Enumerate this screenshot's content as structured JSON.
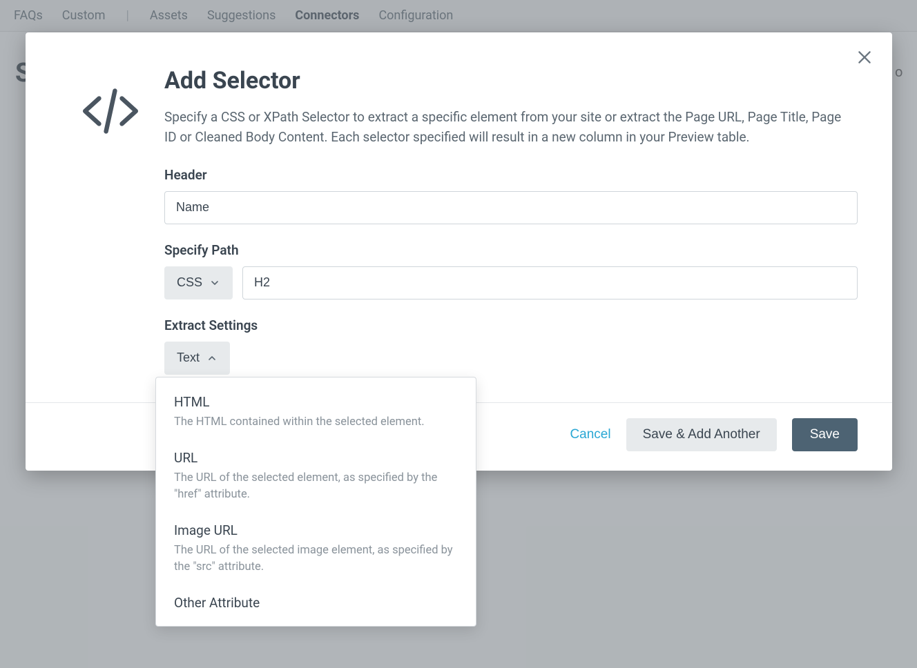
{
  "nav": {
    "items": [
      "FAQs",
      "Custom",
      "|",
      "Assets",
      "Suggestions",
      "Connectors",
      "Configuration"
    ],
    "active_index": 5
  },
  "bg": {
    "left_letter": "S",
    "right_letter": "o"
  },
  "modal": {
    "title": "Add Selector",
    "description": "Specify a CSS or XPath Selector to extract a specific element from your site or extract the Page URL, Page Title, Page ID or Cleaned Body Content. Each selector specified will result in a new column in your Preview table.",
    "header_label": "Header",
    "header_value": "Name",
    "specify_path_label": "Specify Path",
    "path_type_selected": "CSS",
    "path_value": "H2",
    "extract_label": "Extract Settings",
    "extract_selected": "Text",
    "footer": {
      "cancel": "Cancel",
      "save_another": "Save & Add Another",
      "save": "Save"
    }
  },
  "dropdown": {
    "items": [
      {
        "title": "HTML",
        "desc": "The HTML contained within the selected element."
      },
      {
        "title": "URL",
        "desc": "The URL of the selected element, as specified by the \"href\" attribute."
      },
      {
        "title": "Image URL",
        "desc": "The URL of the selected image element, as specified by the \"src\" attribute."
      },
      {
        "title": "Other Attribute",
        "desc": ""
      }
    ]
  }
}
